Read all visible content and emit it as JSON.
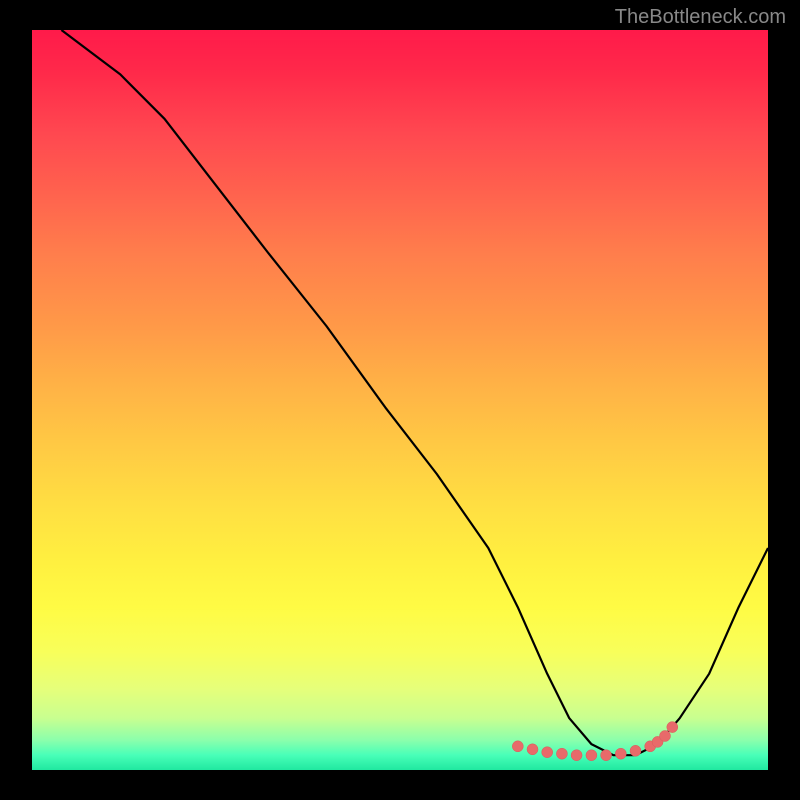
{
  "watermark": "TheBottleneck.com",
  "chart_data": {
    "type": "line",
    "title": "",
    "xlabel": "",
    "ylabel": "",
    "xlim": [
      0,
      100
    ],
    "ylim": [
      0,
      100
    ],
    "series": [
      {
        "name": "curve",
        "x": [
          4,
          8,
          12,
          18,
          25,
          32,
          40,
          48,
          55,
          62,
          66,
          70,
          73,
          76,
          79,
          82,
          85,
          88,
          92,
          96,
          100
        ],
        "y": [
          100,
          97,
          94,
          88,
          79,
          70,
          60,
          49,
          40,
          30,
          22,
          13,
          7,
          3.5,
          2,
          2,
          3.5,
          7,
          13,
          22,
          30
        ]
      }
    ],
    "markers": {
      "x": [
        66,
        68,
        70,
        72,
        74,
        76,
        78,
        80,
        82,
        84,
        85,
        86,
        87
      ],
      "y": [
        3.2,
        2.8,
        2.4,
        2.2,
        2.0,
        2.0,
        2.0,
        2.2,
        2.6,
        3.2,
        3.8,
        4.6,
        5.8
      ]
    }
  }
}
